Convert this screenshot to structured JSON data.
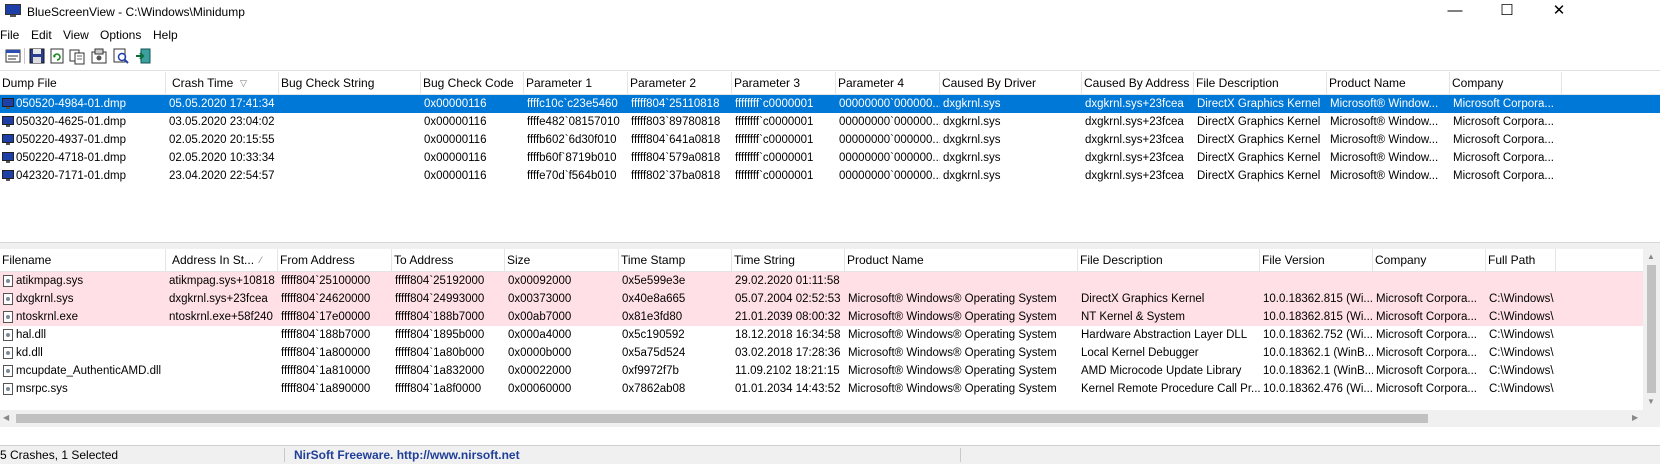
{
  "window": {
    "title": "BlueScreenView  -  C:\\Windows\\Minidump",
    "minimize": "—",
    "maximize": "☐",
    "close": "✕"
  },
  "menu": [
    "File",
    "Edit",
    "View",
    "Options",
    "Help"
  ],
  "toolbar": {
    "icons": [
      "properties-icon",
      "save-icon",
      "refresh-icon",
      "copy-icon",
      "options-icon",
      "find-icon",
      "exit-icon"
    ]
  },
  "crashes": {
    "columns": [
      "Dump File",
      "Crash Time",
      "Bug Check String",
      "Bug Check Code",
      "Parameter 1",
      "Parameter 2",
      "Parameter 3",
      "Parameter 4",
      "Caused By Driver",
      "Caused By Address",
      "File Description",
      "Product Name",
      "Company"
    ],
    "sort_indicator": "▽",
    "rows": [
      [
        "050520-4984-01.dmp",
        "05.05.2020 17:41:34",
        "",
        "0x00000116",
        "ffffc10c`c23e5460",
        "fffff804`25110818",
        "ffffffff`c0000001",
        "00000000`000000...",
        "dxgkrnl.sys",
        "dxgkrnl.sys+23fcea",
        "DirectX Graphics Kernel",
        "Microsoft® Window...",
        "Microsoft Corpora..."
      ],
      [
        "050320-4625-01.dmp",
        "03.05.2020 23:04:02",
        "",
        "0x00000116",
        "ffffe482`08157010",
        "fffff803`89780818",
        "ffffffff`c0000001",
        "00000000`000000...",
        "dxgkrnl.sys",
        "dxgkrnl.sys+23fcea",
        "DirectX Graphics Kernel",
        "Microsoft® Window...",
        "Microsoft Corpora..."
      ],
      [
        "050220-4937-01.dmp",
        "02.05.2020 20:15:55",
        "",
        "0x00000116",
        "ffffb602`6d30f010",
        "fffff804`641a0818",
        "ffffffff`c0000001",
        "00000000`000000...",
        "dxgkrnl.sys",
        "dxgkrnl.sys+23fcea",
        "DirectX Graphics Kernel",
        "Microsoft® Window...",
        "Microsoft Corpora..."
      ],
      [
        "050220-4718-01.dmp",
        "02.05.2020 10:33:34",
        "",
        "0x00000116",
        "ffffb60f`8719b010",
        "fffff804`579a0818",
        "ffffffff`c0000001",
        "00000000`000000...",
        "dxgkrnl.sys",
        "dxgkrnl.sys+23fcea",
        "DirectX Graphics Kernel",
        "Microsoft® Window...",
        "Microsoft Corpora..."
      ],
      [
        "042320-7171-01.dmp",
        "23.04.2020 22:54:57",
        "",
        "0x00000116",
        "ffffe70d`f564b010",
        "fffff802`37ba0818",
        "ffffffff`c0000001",
        "00000000`000000...",
        "dxgkrnl.sys",
        "dxgkrnl.sys+23fcea",
        "DirectX Graphics Kernel",
        "Microsoft® Window...",
        "Microsoft Corpora..."
      ]
    ]
  },
  "drivers": {
    "columns": [
      "Filename",
      "Address In St...",
      "From Address",
      "To Address",
      "Size",
      "Time Stamp",
      "Time String",
      "Product Name",
      "File Description",
      "File Version",
      "Company",
      "Full Path"
    ],
    "sort_indicator": "⁄",
    "rows": [
      [
        "atikmpag.sys",
        "atikmpag.sys+10818",
        "fffff804`25100000",
        "fffff804`25192000",
        "0x00092000",
        "0x5e599e3e",
        "29.02.2020 01:11:58",
        "",
        "",
        "",
        "",
        ""
      ],
      [
        "dxgkrnl.sys",
        "dxgkrnl.sys+23fcea",
        "fffff804`24620000",
        "fffff804`24993000",
        "0x00373000",
        "0x40e8a665",
        "05.07.2004 02:52:53",
        "Microsoft® Windows® Operating System",
        "DirectX Graphics Kernel",
        "10.0.18362.815 (Wi...",
        "Microsoft Corpora...",
        "C:\\Windows\\"
      ],
      [
        "ntoskrnl.exe",
        "ntoskrnl.exe+58f240",
        "fffff804`17e00000",
        "fffff804`188b7000",
        "0x00ab7000",
        "0x81e3fd80",
        "21.01.2039 08:00:32",
        "Microsoft® Windows® Operating System",
        "NT Kernel & System",
        "10.0.18362.815 (Wi...",
        "Microsoft Corpora...",
        "C:\\Windows\\"
      ],
      [
        "hal.dll",
        "",
        "fffff804`188b7000",
        "fffff804`1895b000",
        "0x000a4000",
        "0x5c190592",
        "18.12.2018 16:34:58",
        "Microsoft® Windows® Operating System",
        "Hardware Abstraction Layer DLL",
        "10.0.18362.752 (Wi...",
        "Microsoft Corpora...",
        "C:\\Windows\\"
      ],
      [
        "kd.dll",
        "",
        "fffff804`1a800000",
        "fffff804`1a80b000",
        "0x0000b000",
        "0x5a75d524",
        "03.02.2018 17:28:36",
        "Microsoft® Windows® Operating System",
        "Local Kernel Debugger",
        "10.0.18362.1 (WinB...",
        "Microsoft Corpora...",
        "C:\\Windows\\"
      ],
      [
        "mcupdate_AuthenticAMD.dll",
        "",
        "fffff804`1a810000",
        "fffff804`1a832000",
        "0x00022000",
        "0xf9972f7b",
        "11.09.2102 18:21:15",
        "Microsoft® Windows® Operating System",
        "AMD Microcode Update Library",
        "10.0.18362.1 (WinB...",
        "Microsoft Corpora...",
        "C:\\Windows\\"
      ],
      [
        "msrpc.sys",
        "",
        "fffff804`1a890000",
        "fffff804`1a8f0000",
        "0x00060000",
        "0x7862ab08",
        "01.01.2034 14:43:52",
        "Microsoft® Windows® Operating System",
        "Kernel Remote Procedure Call Pr...",
        "10.0.18362.476 (Wi...",
        "Microsoft Corpora...",
        "C:\\Windows\\"
      ]
    ]
  },
  "status": {
    "count": "5 Crashes, 1 Selected",
    "credit": "NirSoft Freeware.  http://www.nirsoft.net"
  },
  "colors": {
    "selection": "#0078d7",
    "highlight": "#ffe0e6",
    "credit": "#1f3f99"
  }
}
